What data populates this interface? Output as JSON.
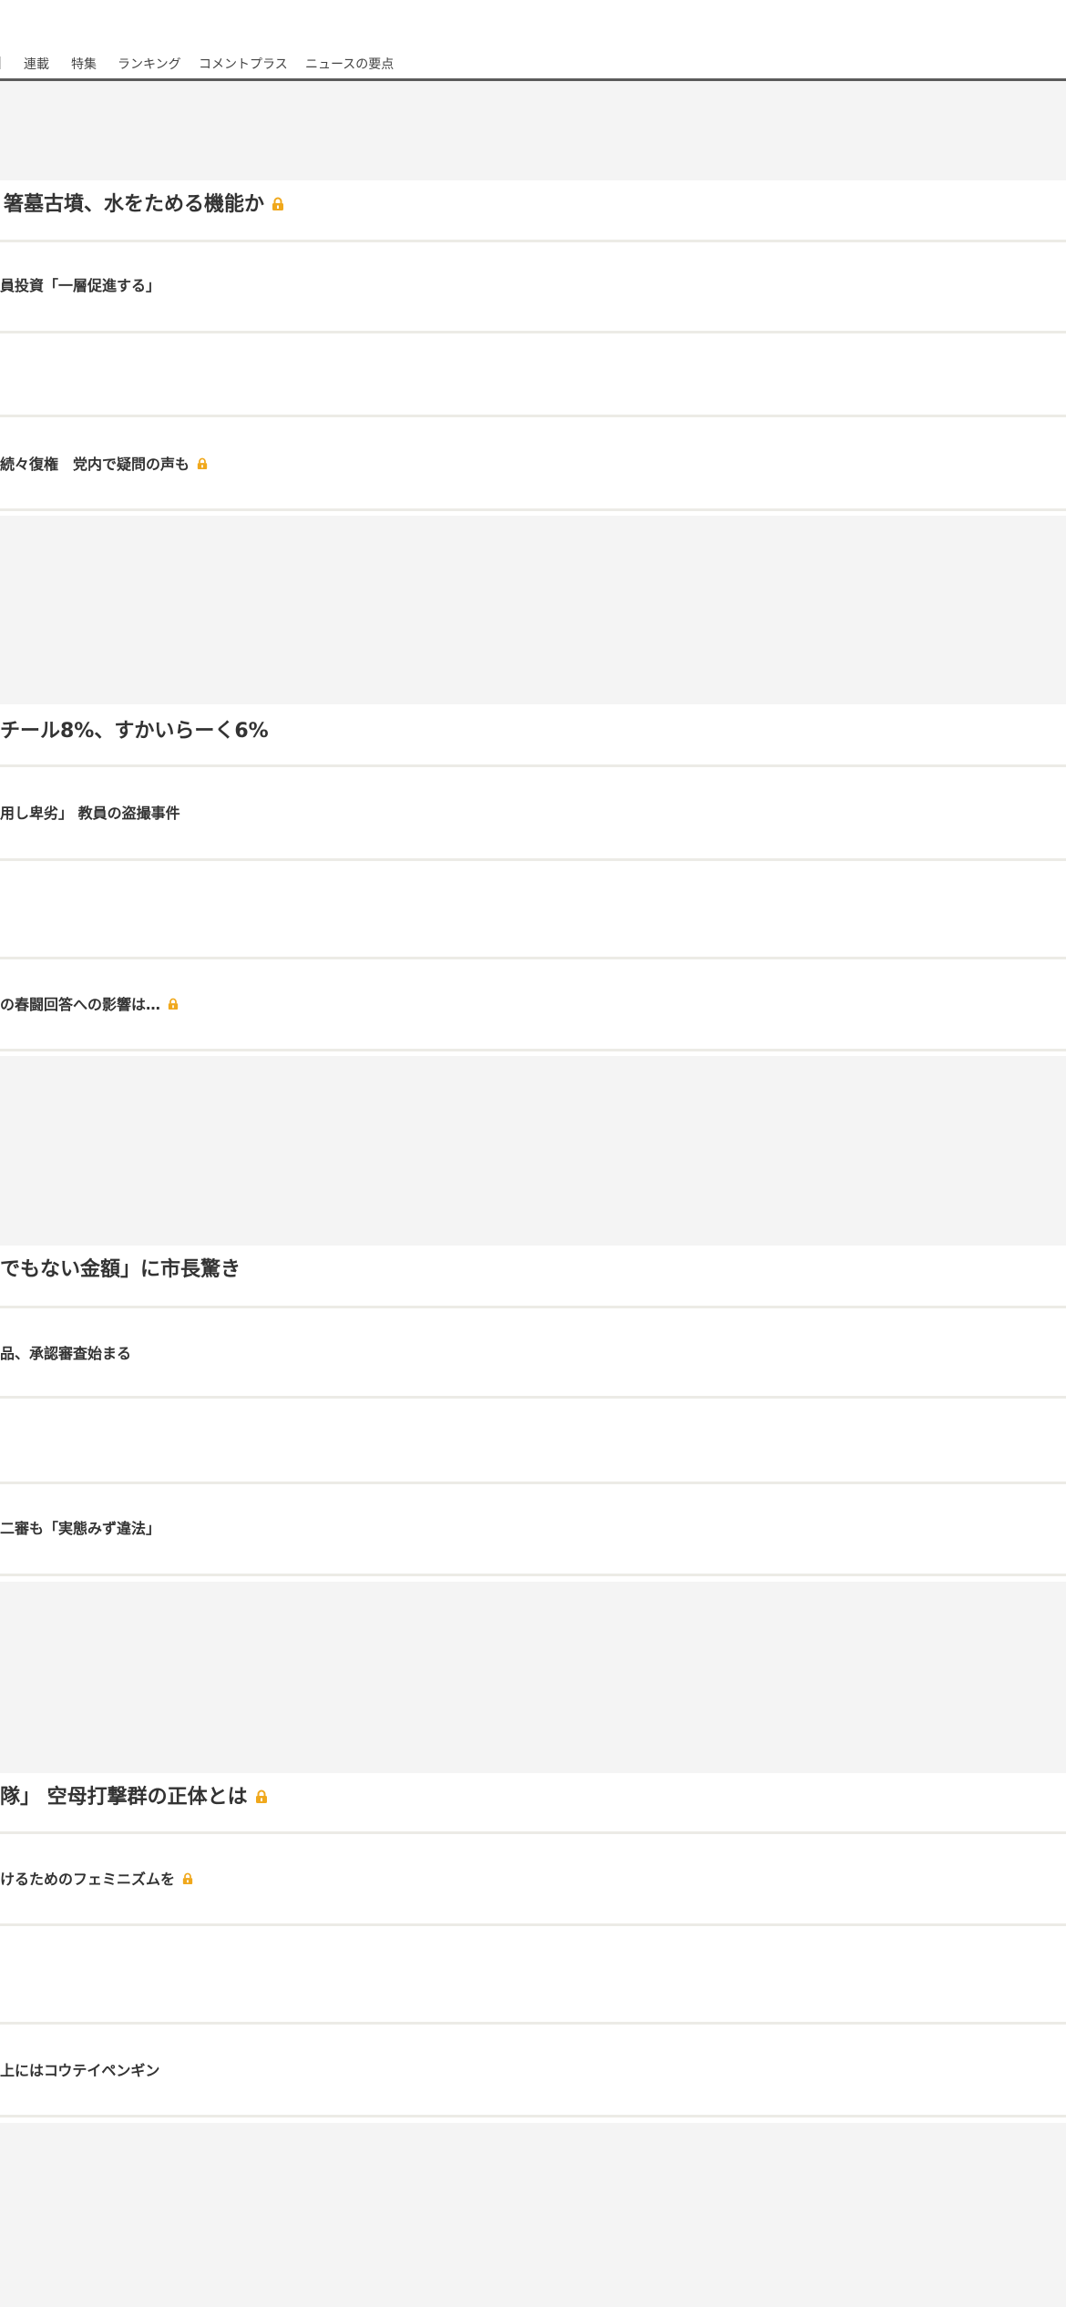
{
  "nav": {
    "items": [
      "連載",
      "特集",
      "ランキング",
      "コメントプラス",
      "ニュースの要点"
    ]
  },
  "colors": {
    "lock": "#f0a81c",
    "ad_bg": "#f4f4f4",
    "nav_underline": "#5b5b5b"
  },
  "articles": [
    {
      "title": "箸墓古墳、水をためる機能か",
      "locked": true,
      "style": "large"
    },
    {
      "title": "員投資「一層促進する」",
      "locked": false,
      "style": "small"
    },
    {
      "title": "続々復権　党内で疑問の声も",
      "locked": true,
      "style": "small"
    },
    {
      "title": "チール8%、すかいらーく6%",
      "locked": false,
      "style": "large"
    },
    {
      "title": "用し卑劣」 教員の盗撮事件",
      "locked": false,
      "style": "small"
    },
    {
      "title": "の春闘回答への影響は…",
      "locked": true,
      "style": "small"
    },
    {
      "title": "でもない金額」に市長驚き",
      "locked": false,
      "style": "large"
    },
    {
      "title": "品、承認審査始まる",
      "locked": false,
      "style": "small"
    },
    {
      "title": "二審も「実態みず違法」",
      "locked": false,
      "style": "small"
    },
    {
      "title": "隊」 空母打撃群の正体とは",
      "locked": true,
      "style": "large"
    },
    {
      "title": "けるためのフェミニズムを",
      "locked": true,
      "style": "small"
    },
    {
      "title": "上にはコウテイペンギン",
      "locked": false,
      "style": "small"
    }
  ]
}
